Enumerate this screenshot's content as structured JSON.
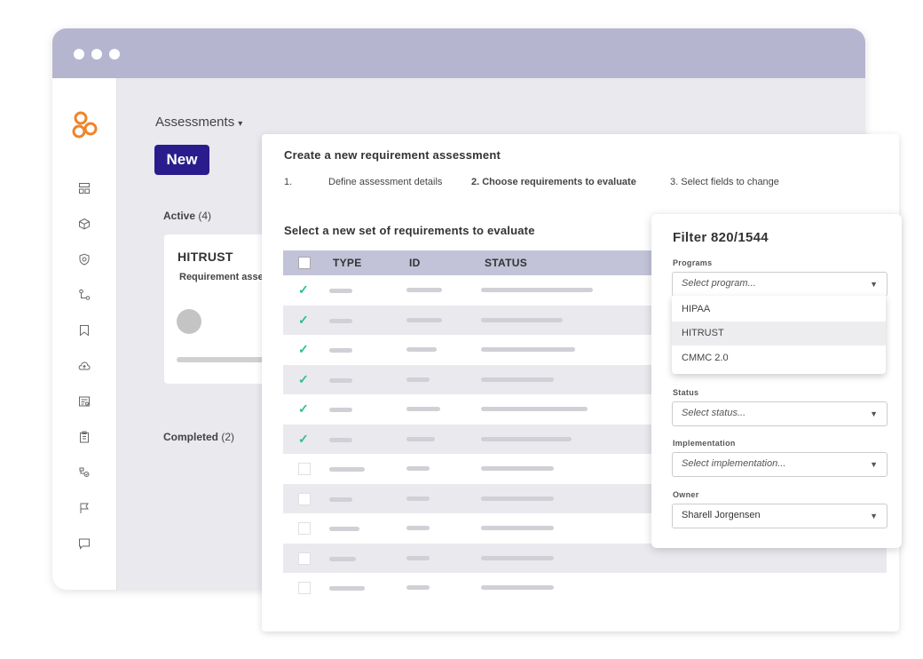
{
  "sidebar": {
    "icons": [
      "dashboard-icon",
      "box-icon",
      "shield-icon",
      "workflow-icon",
      "bookmark-icon",
      "cloud-upload-icon",
      "report-icon",
      "clipboard-icon",
      "users-icon",
      "flag-icon",
      "chat-icon"
    ]
  },
  "header": {
    "title": "Assessments",
    "caret": "▾",
    "new_button": "New"
  },
  "lists": {
    "active_label": "Active",
    "active_count": "(4)",
    "completed_label": "Completed",
    "completed_count": "(2)"
  },
  "card": {
    "title": "HITRUST",
    "subtitle": "Requirement assessment"
  },
  "wizard": {
    "title": "Create a new requirement assessment",
    "steps": [
      {
        "label": "1.",
        "active": false
      },
      {
        "label": "Define assessment details",
        "active": false
      },
      {
        "label": "2. Choose requirements to evaluate",
        "active": true
      },
      {
        "label": "3. Select fields to change",
        "active": false
      }
    ],
    "section_title": "Select a new set of requirements to evaluate",
    "columns": [
      "TYPE",
      "ID",
      "STATUS"
    ],
    "rows": [
      {
        "checked": true
      },
      {
        "checked": true
      },
      {
        "checked": true
      },
      {
        "checked": true
      },
      {
        "checked": true
      },
      {
        "checked": true
      },
      {
        "checked": false
      },
      {
        "checked": false
      },
      {
        "checked": false
      },
      {
        "checked": false
      },
      {
        "checked": false
      }
    ],
    "check_mark": "✓"
  },
  "filter": {
    "title": "Filter 820/1544",
    "programs_label": "Programs",
    "programs_placeholder": "Select program...",
    "program_options": [
      "HIPAA",
      "HITRUST",
      "CMMC 2.0"
    ],
    "highlighted_option": "HITRUST",
    "status_label": "Status",
    "status_placeholder": "Select status...",
    "implementation_label": "Implementation",
    "implementation_placeholder": "Select implementation...",
    "owner_label": "Owner",
    "owner_value": "Sharell Jorgensen",
    "arrow": "▼"
  },
  "colors": {
    "titlebar": "#b5b5d0",
    "new_button": "#2a1c8c",
    "logo": "#f0842c",
    "check": "#2dc08d",
    "table_header": "#c2c2d8"
  }
}
